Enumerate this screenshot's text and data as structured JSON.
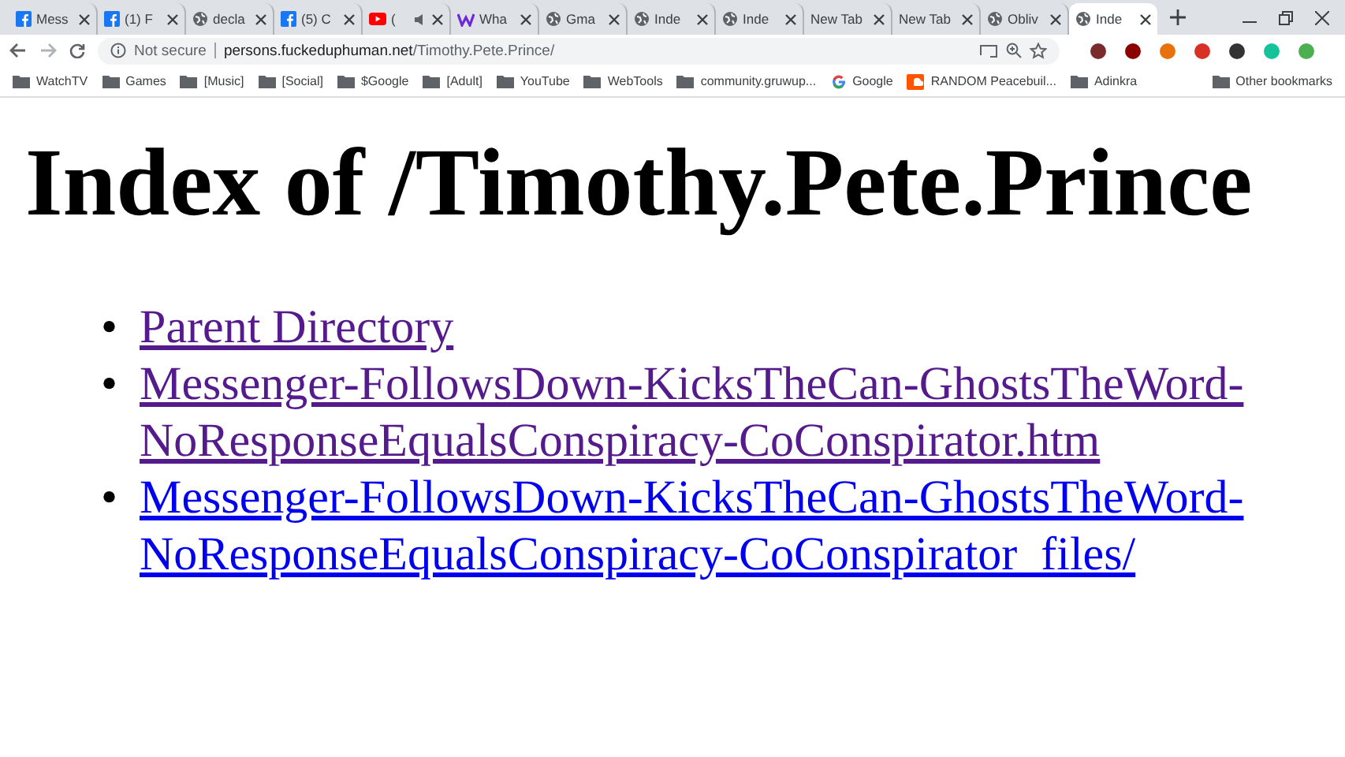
{
  "tabs": [
    {
      "title": "Mess",
      "kind": "facebook",
      "audio": false,
      "selected": false
    },
    {
      "title": "(1) F",
      "kind": "facebook",
      "audio": false,
      "selected": false
    },
    {
      "title": "decla",
      "kind": "globe",
      "audio": false,
      "selected": false
    },
    {
      "title": "(5) C",
      "kind": "facebook",
      "audio": false,
      "selected": false
    },
    {
      "title": "(",
      "kind": "youtube",
      "audio": true,
      "selected": false
    },
    {
      "title": "Wha",
      "kind": "w",
      "audio": false,
      "selected": false
    },
    {
      "title": "Gma",
      "kind": "globe",
      "audio": false,
      "selected": false
    },
    {
      "title": "Inde",
      "kind": "globe",
      "audio": false,
      "selected": false
    },
    {
      "title": "Inde",
      "kind": "globe",
      "audio": false,
      "selected": false
    },
    {
      "title": "New Tab",
      "kind": "blank",
      "audio": false,
      "selected": false
    },
    {
      "title": "New Tab",
      "kind": "blank",
      "audio": false,
      "selected": false
    },
    {
      "title": "Obliv",
      "kind": "globe",
      "audio": false,
      "selected": false
    },
    {
      "title": "Inde",
      "kind": "globe",
      "audio": false,
      "selected": true
    }
  ],
  "address": {
    "security": "Not secure",
    "host": "persons.fuckeduphuman.net",
    "path": "/Timothy.Pete.Prince/"
  },
  "bookmarks": [
    {
      "label": "WatchTV",
      "kind": "folder"
    },
    {
      "label": "Games",
      "kind": "folder"
    },
    {
      "label": "[Music]",
      "kind": "folder"
    },
    {
      "label": "[Social]",
      "kind": "folder"
    },
    {
      "label": "$Google",
      "kind": "folder"
    },
    {
      "label": "[Adult]",
      "kind": "folder"
    },
    {
      "label": "YouTube",
      "kind": "folder"
    },
    {
      "label": "WebTools",
      "kind": "folder"
    },
    {
      "label": "community.gruwup...",
      "kind": "folder"
    },
    {
      "label": "Google",
      "kind": "google"
    },
    {
      "label": "RANDOM Peacebuil...",
      "kind": "soundcloud"
    },
    {
      "label": "Adinkra",
      "kind": "folder"
    }
  ],
  "other_bookmarks": "Other bookmarks",
  "heading": "Index of /Timothy.Pete.Prince",
  "links": [
    {
      "bullet": "•",
      "text": "Parent Directory",
      "visited": true
    },
    {
      "bullet": "•",
      "text": "Messenger-FollowsDown-KicksTheCan-GhostsTheWord-NoResponseEqualsConspiracy-CoConspirator.htm",
      "visited": true
    },
    {
      "bullet": "•",
      "text": "Messenger-FollowsDown-KicksTheCan-GhostsTheWord-NoResponseEqualsConspiracy-CoConspirator_files/",
      "visited": false
    }
  ]
}
